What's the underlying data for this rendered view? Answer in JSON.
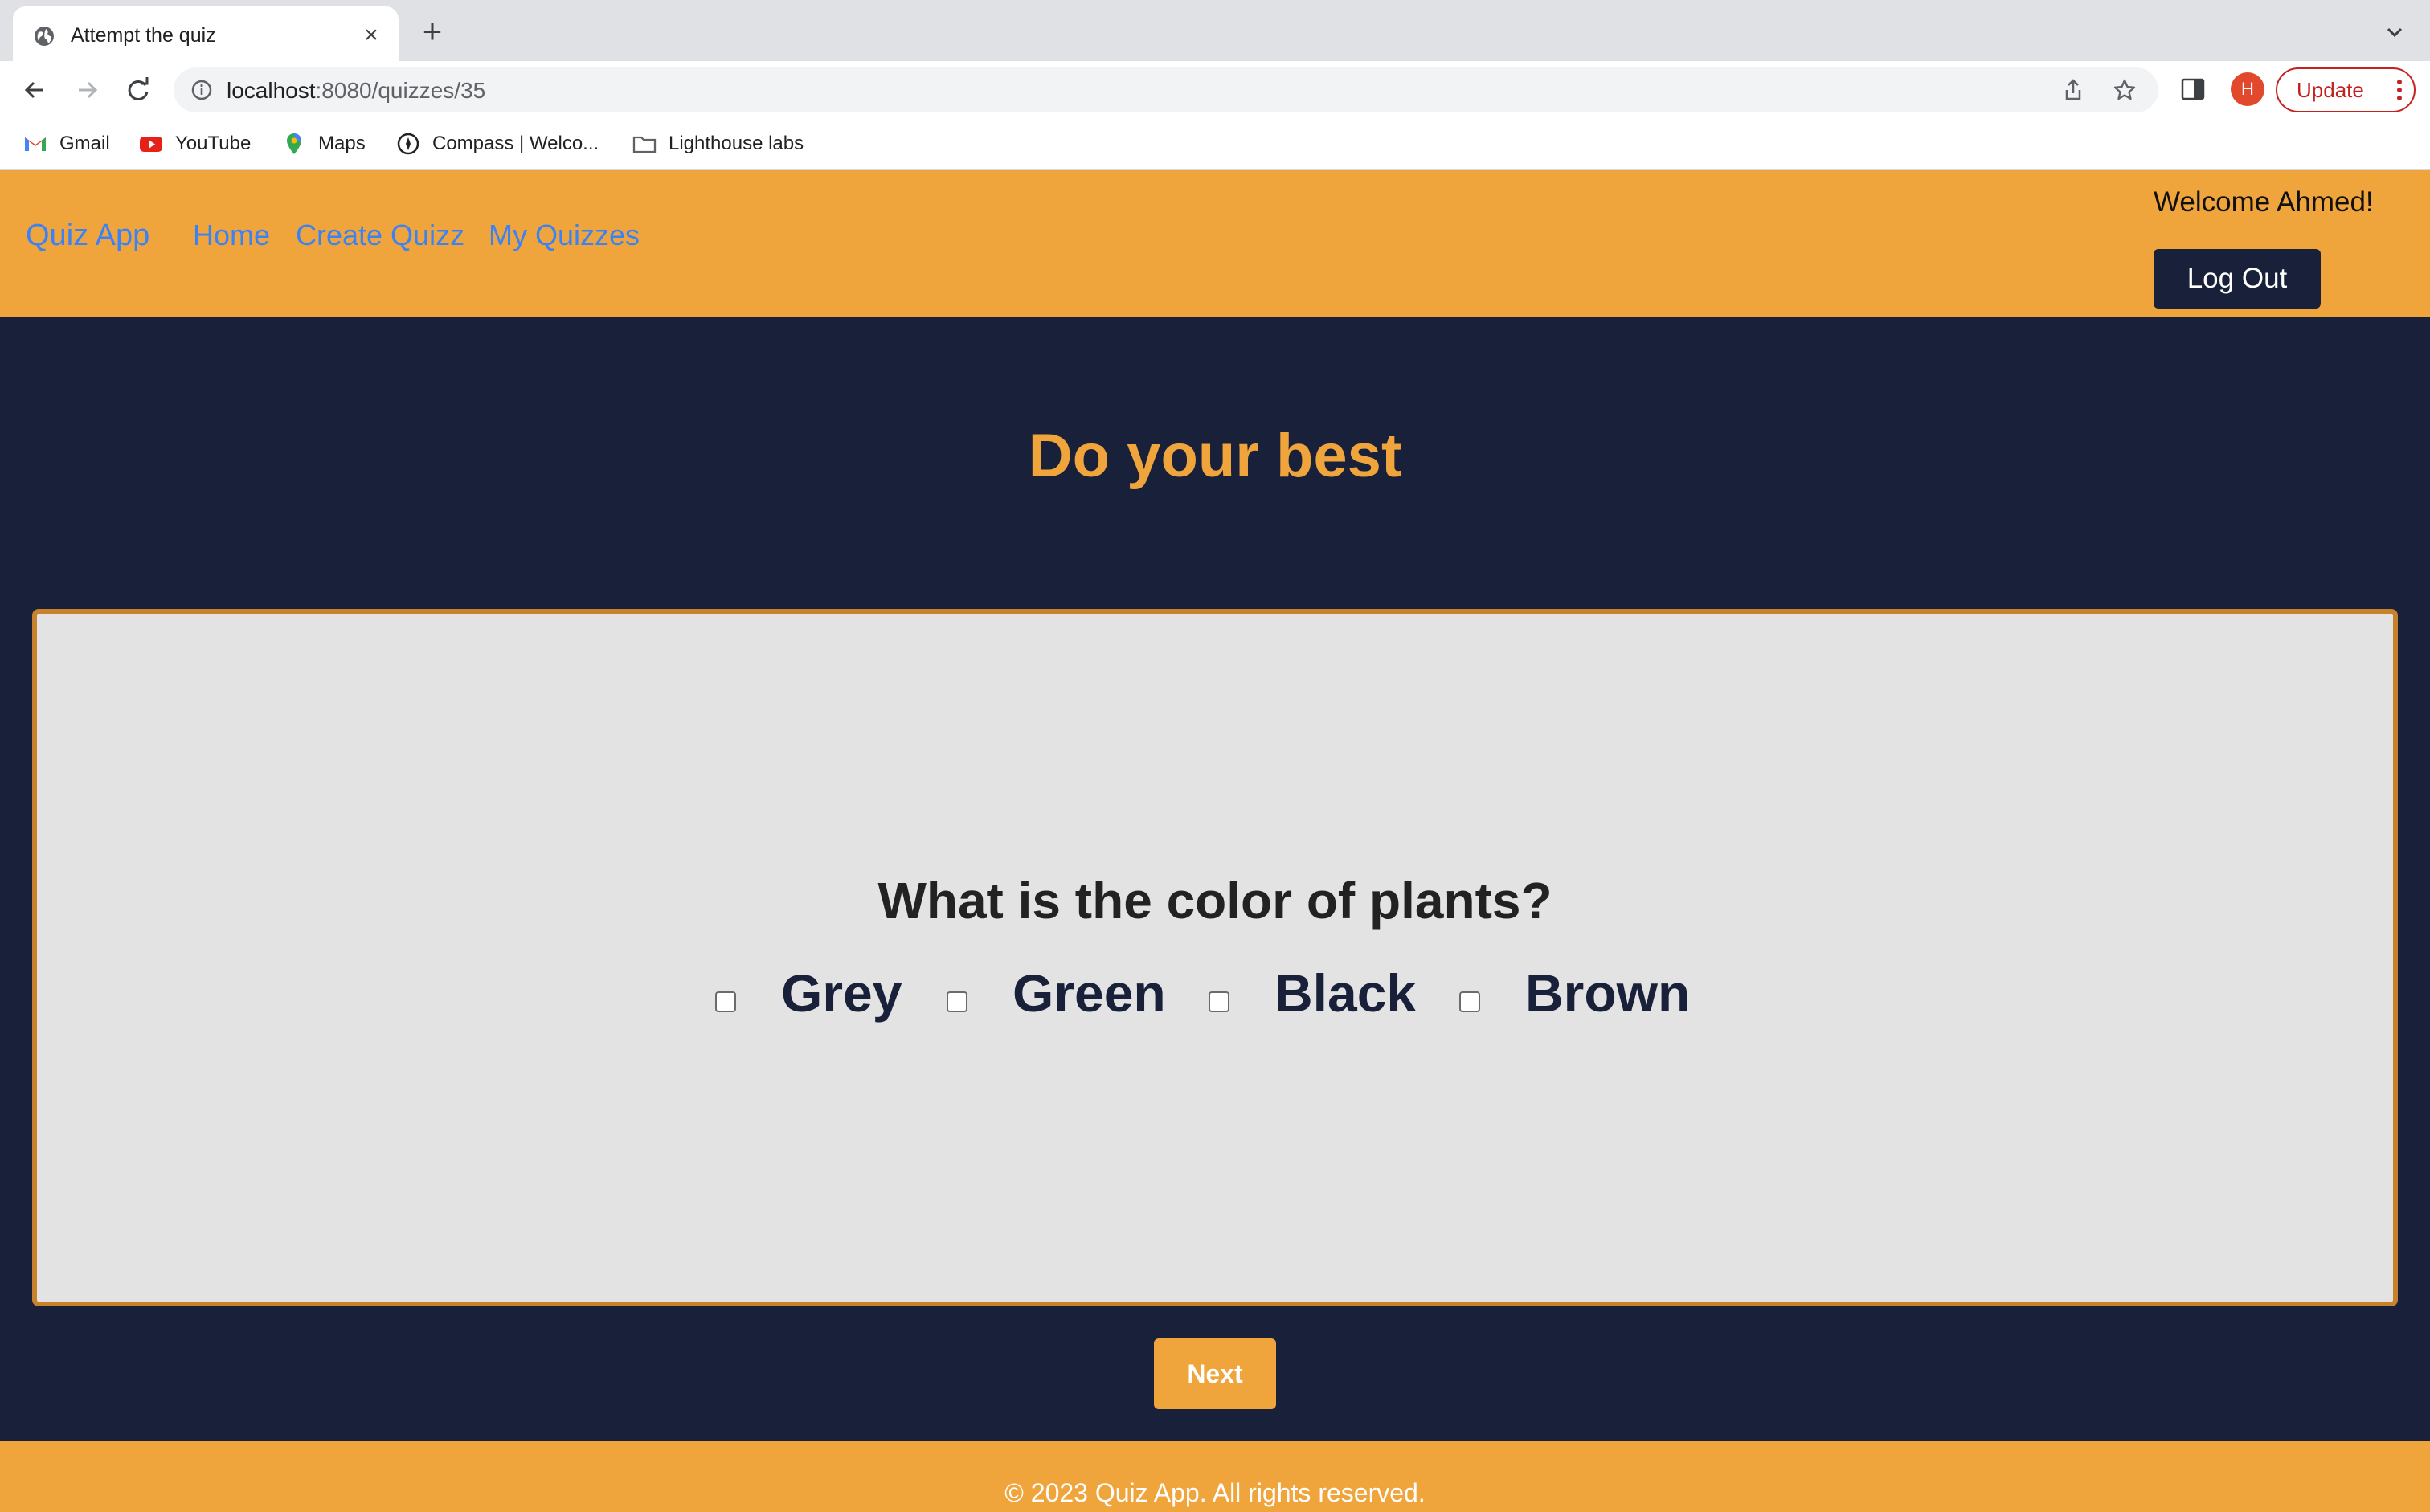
{
  "browser": {
    "tab": {
      "title": "Attempt the quiz"
    },
    "url": {
      "host": "localhost",
      "path": ":8080/quizzes/35"
    },
    "profile_initial": "H",
    "update_label": "Update",
    "bookmarks": [
      {
        "label": "Gmail",
        "icon": "gmail-icon"
      },
      {
        "label": "YouTube",
        "icon": "youtube-icon"
      },
      {
        "label": "Maps",
        "icon": "maps-icon"
      },
      {
        "label": "Compass | Welco...",
        "icon": "compass-icon"
      },
      {
        "label": "Lighthouse labs",
        "icon": "folder-icon"
      }
    ]
  },
  "app": {
    "brand": "Quiz App",
    "nav": [
      {
        "label": "Home"
      },
      {
        "label": "Create Quizz"
      },
      {
        "label": "My Quizzes"
      }
    ],
    "welcome": "Welcome Ahmed!",
    "logout_label": "Log Out"
  },
  "page": {
    "heading": "Do your best",
    "question": "What is the color of plants?",
    "options": [
      {
        "label": "Grey",
        "checked": false
      },
      {
        "label": "Green",
        "checked": false
      },
      {
        "label": "Black",
        "checked": false
      },
      {
        "label": "Brown",
        "checked": false
      }
    ],
    "next_label": "Next"
  },
  "footer": {
    "text": "© 2023 Quiz App. All rights reserved."
  },
  "colors": {
    "header_bg": "#efa53c",
    "body_bg": "#192039",
    "link": "#3b82f6",
    "card_bg": "#e3e3e3"
  }
}
